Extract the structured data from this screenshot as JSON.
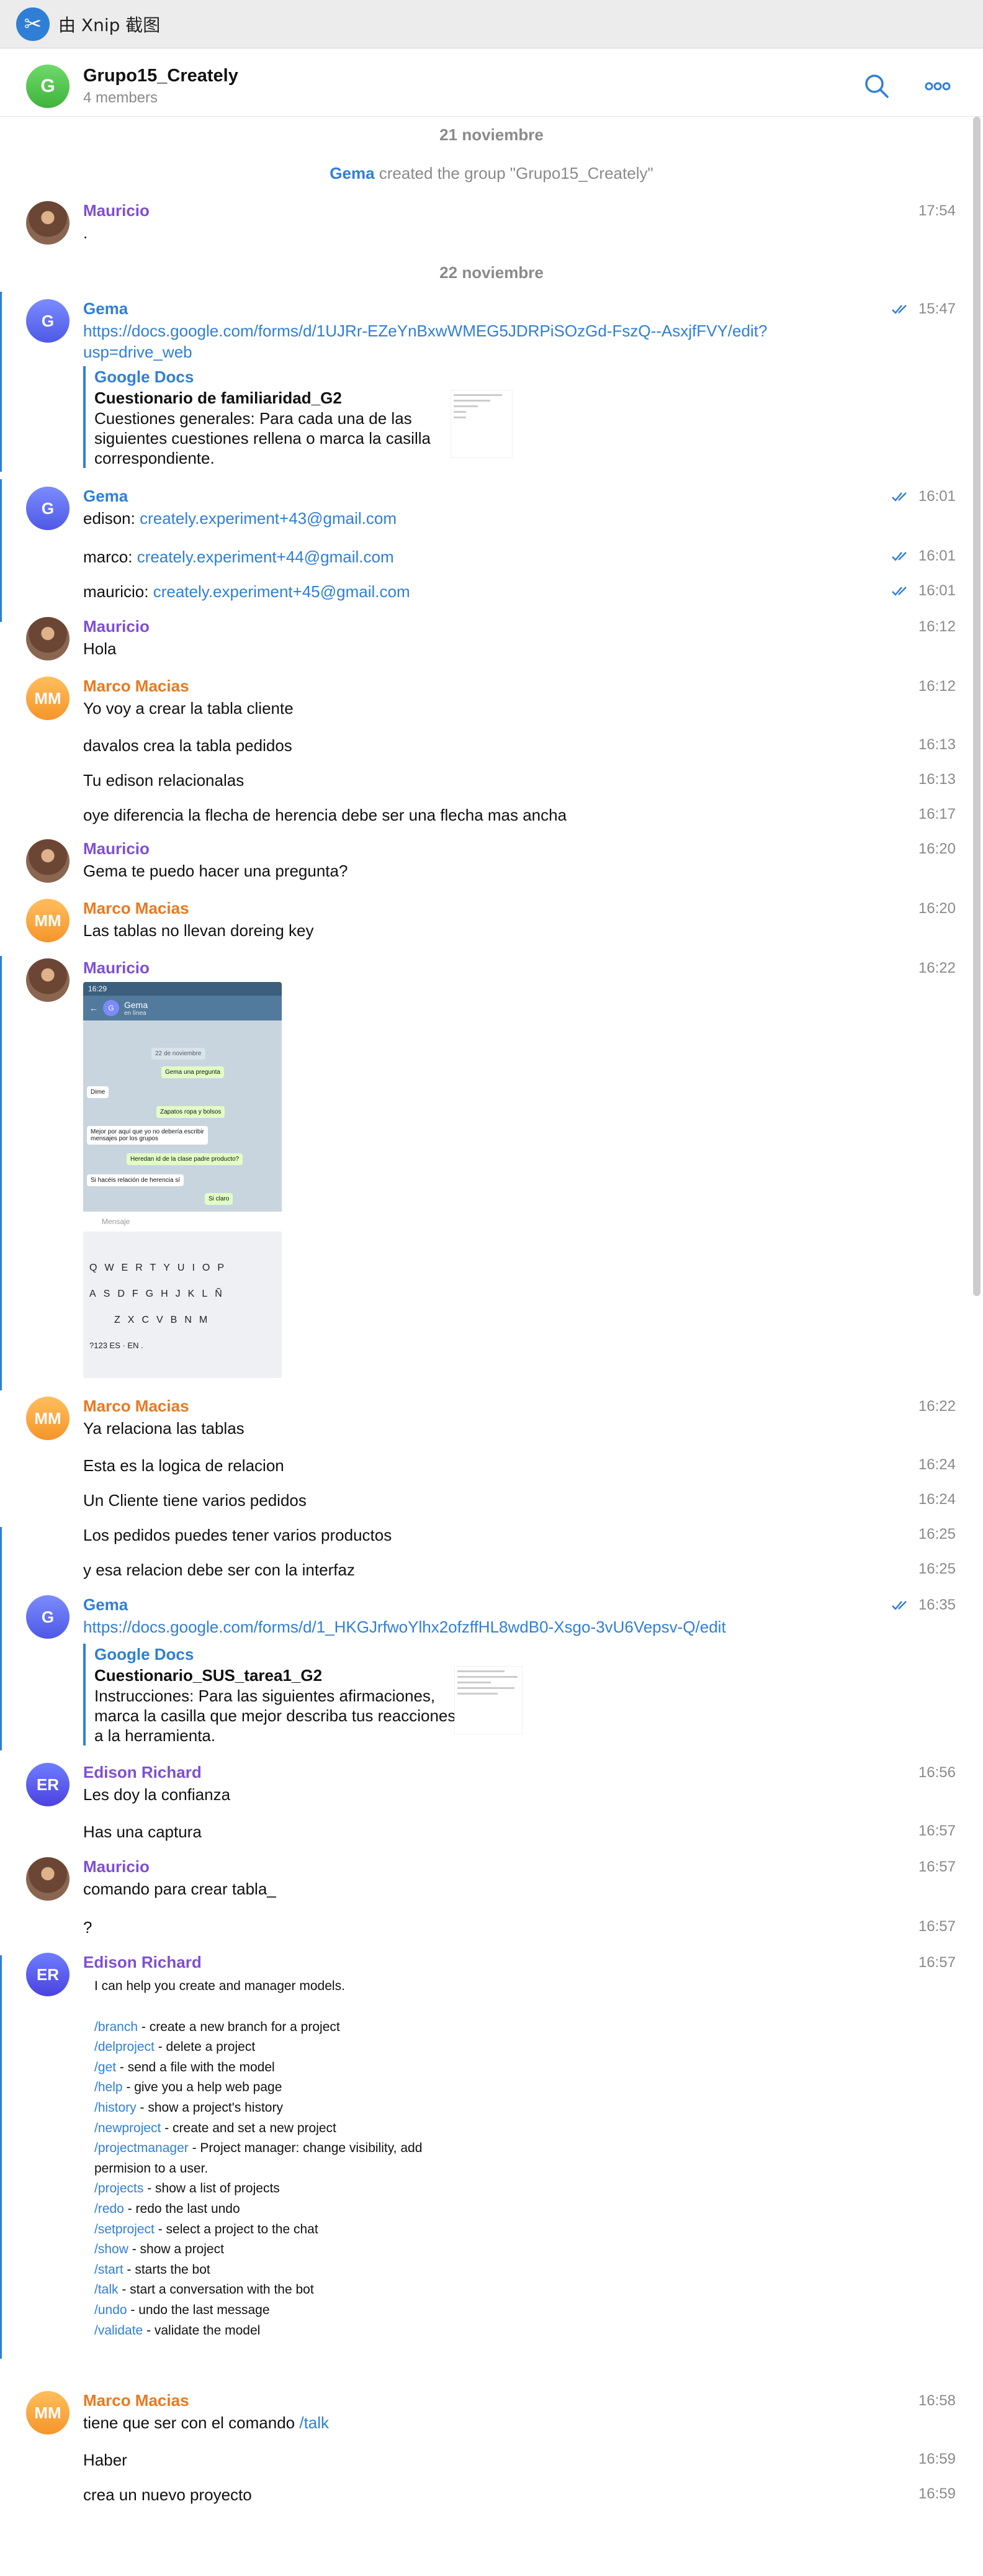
{
  "window": {
    "title": "由 Xnip 截图",
    "logo_icon": "xnip-logo-icon"
  },
  "chat": {
    "avatar_letter": "G",
    "name": "Grupo15_Creately",
    "members": "4 members"
  },
  "dates": {
    "d1": "21 noviembre",
    "d2": "22 noviembre"
  },
  "service": {
    "name": "Gema",
    "text": " created the group \"Grupo15_Creately\""
  },
  "senders": {
    "mauricio": "Mauricio",
    "gema": "Gema",
    "marco": "Marco Macias",
    "edison": "Edison Richard"
  },
  "initials": {
    "gema": "G",
    "marco": "MM",
    "edison": "ER"
  },
  "messages": {
    "m1": {
      "text": ".",
      "time": "17:54"
    },
    "m2": {
      "link1": "https://docs.google.com/forms/d/1UJRr-EZeYnBxwWMEG5JDRPiSOzGd-FszQ--AsxjfFVY/edit?",
      "link2": "usp=drive_web",
      "time": "15:47",
      "preview": {
        "site": "Google Docs",
        "title": "Cuestionario de familiaridad_G2",
        "desc": "Cuestiones generales: Para cada una de las siguientes cuestiones rellena o marca la casilla correspondiente."
      }
    },
    "m3": {
      "label": "edison: ",
      "link": "creately.experiment+43@gmail.com",
      "time": "16:01"
    },
    "m4": {
      "label": "marco: ",
      "link": "creately.experiment+44@gmail.com",
      "time": "16:01"
    },
    "m5": {
      "label": "mauricio: ",
      "link": "creately.experiment+45@gmail.com",
      "time": "16:01"
    },
    "m6": {
      "text": "Hola",
      "time": "16:12"
    },
    "m7": {
      "text": "Yo voy a crear la tabla cliente",
      "time": "16:12"
    },
    "m8": {
      "text": "davalos crea la tabla pedidos",
      "time": "16:13"
    },
    "m9": {
      "text": "Tu edison relacionalas",
      "time": "16:13"
    },
    "m10": {
      "text": "oye diferencia la flecha de herencia debe ser una flecha mas ancha",
      "time": "16:17"
    },
    "m11": {
      "text": "Gema te puedo hacer una pregunta?",
      "time": "16:20"
    },
    "m12": {
      "text": "Las tablas no llevan doreing key",
      "time": "16:20"
    },
    "m13": {
      "time": "16:22",
      "screenshot": {
        "status": "16:29",
        "chat_name": "Gema",
        "chat_status": "en línea",
        "date_chip": "22 de noviembre",
        "b1": "Gema una pregunta",
        "b2": "Dime",
        "b3": "Zapatos ropa y bolsos",
        "b4": "Mejor por aquí que yo no debería escribir",
        "b4b": "mensajes por los grupos",
        "b5": "Heredan id de la clase padre producto?",
        "b6": "Si hacéis relación de herencia sí",
        "b7": "Si claro",
        "placeholder": "Mensaje",
        "row1": "QWERTYUIOP",
        "row2": "ASDFGHJKLÑ",
        "row3": "ZXCVBNM",
        "row4": "?123   ES · EN   ."
      }
    },
    "m14": {
      "text": "Ya relaciona las tablas",
      "time": "16:22"
    },
    "m15": {
      "text": "Esta es la logica de relacion",
      "time": "16:24"
    },
    "m16": {
      "text": "Un Cliente tiene varios pedidos",
      "time": "16:24"
    },
    "m17": {
      "text": "Los pedidos puedes tener varios productos",
      "time": "16:25"
    },
    "m18": {
      "text": "y esa relacion debe ser con la interfaz",
      "time": "16:25"
    },
    "m19": {
      "link": "https://docs.google.com/forms/d/1_HKGJrfwoYlhx2ofzffHL8wdB0-Xsgo-3vU6Vepsv-Q/edit",
      "time": "16:35",
      "preview": {
        "site": "Google Docs",
        "title": "Cuestionario_SUS_tarea1_G2",
        "desc": "Instrucciones: Para las siguientes afirmaciones, marca la casilla que mejor describa tus reacciones a la herramienta."
      }
    },
    "m20": {
      "text": "Les doy la confianza",
      "time": "16:56"
    },
    "m21": {
      "text": "Has una captura",
      "time": "16:57"
    },
    "m22": {
      "text": "comando para crear tabla_",
      "time": "16:57"
    },
    "m23": {
      "text": "?",
      "time": "16:57"
    },
    "m24": {
      "time": "16:57",
      "intro": "I can help you create and manager models.",
      "commands": [
        {
          "cmd": "/branch",
          "desc": " - create a new branch for a project"
        },
        {
          "cmd": "/delproject",
          "desc": " - delete a project"
        },
        {
          "cmd": "/get",
          "desc": " - send a file with the model"
        },
        {
          "cmd": "/help",
          "desc": " - give you a help web page"
        },
        {
          "cmd": "/history",
          "desc": " - show a project's history"
        },
        {
          "cmd": "/newproject",
          "desc": " - create and set a new project"
        },
        {
          "cmd": "/projectmanager",
          "desc": " - Project manager: change visibility, add"
        },
        {
          "cmd": "",
          "desc": "permision to a user."
        },
        {
          "cmd": "/projects",
          "desc": " - show a list of projects"
        },
        {
          "cmd": "/redo",
          "desc": " - redo the last undo"
        },
        {
          "cmd": "/setproject",
          "desc": " - select a project to the chat"
        },
        {
          "cmd": "/show",
          "desc": " - show a project"
        },
        {
          "cmd": "/start",
          "desc": " - starts the bot"
        },
        {
          "cmd": "/talk",
          "desc": " - start a conversation with the bot"
        },
        {
          "cmd": "/undo",
          "desc": " - undo the last message"
        },
        {
          "cmd": "/validate",
          "desc": " - validate the model"
        }
      ]
    },
    "m25": {
      "text": "tiene que ser con el comando ",
      "link": "/talk",
      "time": "16:58"
    },
    "m26": {
      "text": "Haber",
      "time": "16:59"
    },
    "m27": {
      "text": "crea un nuevo proyecto",
      "time": "16:59"
    }
  },
  "colors": {
    "accent": "#2f7fd6",
    "mauricio": "#7f4fd1",
    "marco": "#e8791f"
  }
}
